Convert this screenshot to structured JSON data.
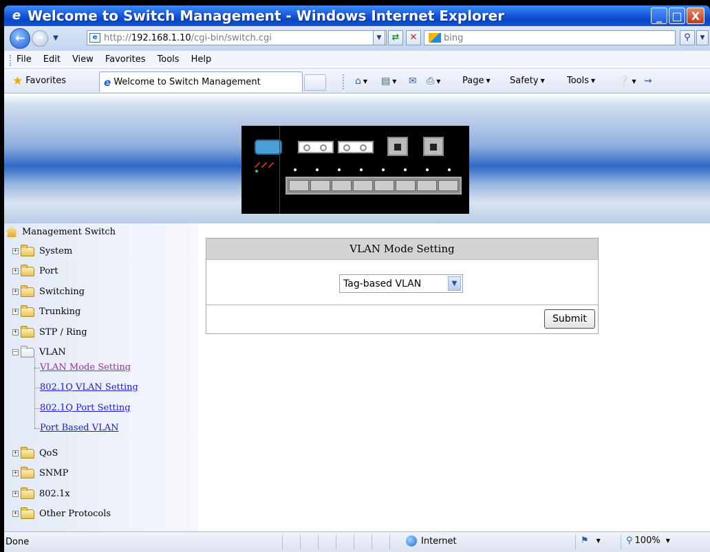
{
  "window": {
    "title": "Welcome to Switch Management - Windows Internet Explorer",
    "min_glyph": "_",
    "max_glyph": "□",
    "close_glyph": "X"
  },
  "address": {
    "url_prefix": "http://",
    "url_host": "192.168.1.10",
    "url_path": "/cgi-bin/switch.cgi",
    "search_placeholder": "bing"
  },
  "menu": {
    "items": [
      "File",
      "Edit",
      "View",
      "Favorites",
      "Tools",
      "Help"
    ]
  },
  "favorites": {
    "label": "Favorites",
    "tab_title": "Welcome to Switch Management"
  },
  "commandbar": {
    "page": "Page",
    "safety": "Safety",
    "tools": "Tools"
  },
  "sidebar": {
    "root": "Management Switch",
    "folders": [
      {
        "label": "System",
        "expanded": false
      },
      {
        "label": "Port",
        "expanded": false
      },
      {
        "label": "Switching",
        "expanded": false
      },
      {
        "label": "Trunking",
        "expanded": false
      },
      {
        "label": "STP / Ring",
        "expanded": false
      },
      {
        "label": "VLAN",
        "expanded": true
      },
      {
        "label": "QoS",
        "expanded": false
      },
      {
        "label": "SNMP",
        "expanded": false
      },
      {
        "label": "802.1x",
        "expanded": false
      },
      {
        "label": "Other Protocols",
        "expanded": false
      }
    ],
    "vlan_links": [
      {
        "label": "VLAN Mode Setting",
        "visited": true
      },
      {
        "label": "802.1Q VLAN Setting",
        "visited": false
      },
      {
        "label": "802.1Q Port Setting",
        "visited": false
      },
      {
        "label": "Port Based VLAN",
        "visited": false
      }
    ]
  },
  "vlan_form": {
    "heading": "VLAN Mode Setting",
    "mode_selected": "Tag-based VLAN",
    "submit_label": "Submit"
  },
  "status": {
    "text": "Done",
    "zone": "Internet",
    "zoom": "100%"
  },
  "colors": {
    "titlebar": "#1c5fe0",
    "link": "#1a1ad4",
    "link_visited": "#a02c9c",
    "table_header": "#d4d4d4"
  }
}
